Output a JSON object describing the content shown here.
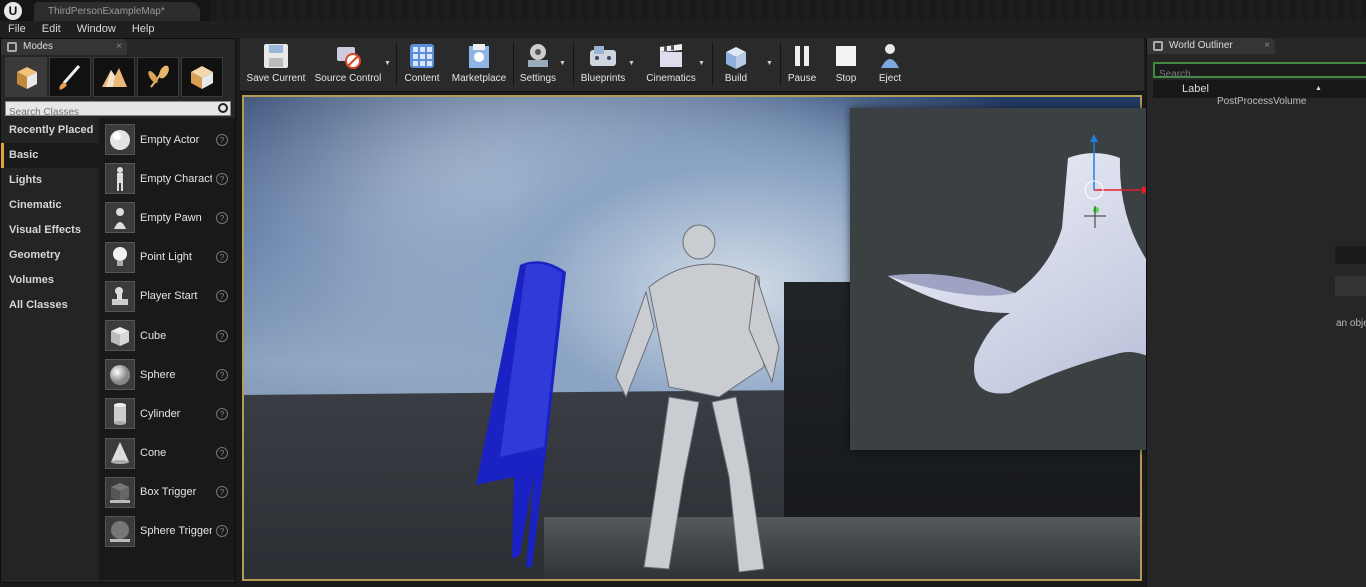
{
  "window": {
    "document_tab": "ThirdPersonExampleMap*",
    "logo": "U"
  },
  "menu": [
    "File",
    "Edit",
    "Window",
    "Help"
  ],
  "modes_panel": {
    "tab_label": "Modes",
    "search_placeholder": "Search Classes",
    "mode_icons": [
      "place-mode-icon",
      "paint-mode-icon",
      "landscape-mode-icon",
      "foliage-mode-icon",
      "geometry-mode-icon"
    ],
    "categories": [
      "Recently Placed",
      "Basic",
      "Lights",
      "Cinematic",
      "Visual Effects",
      "Geometry",
      "Volumes",
      "All Classes"
    ],
    "active_category": "Basic",
    "classes": [
      "Empty Actor",
      "Empty Charact",
      "Empty Pawn",
      "Point Light",
      "Player Start",
      "Cube",
      "Sphere",
      "Cylinder",
      "Cone",
      "Box Trigger",
      "Sphere Trigger"
    ],
    "help_glyph": "?"
  },
  "toolbar": {
    "buttons": [
      "Save Current",
      "Source Control",
      "Content",
      "Marketplace",
      "Settings",
      "Blueprints",
      "Cinematics",
      "Build",
      "Pause",
      "Stop",
      "Eject"
    ]
  },
  "world_outliner": {
    "tab_label": "World Outliner",
    "search_placeholder": "Search...",
    "column_label": "Label",
    "first_row": "PostProcessVolume",
    "partial_text": "an obje"
  },
  "colors": {
    "viewport_border": "#b39b52",
    "active_category_accent": "#e0a33c",
    "search_outline": "#3f8a3f",
    "gizmo_x": "#e0202a",
    "gizmo_z": "#2080e0"
  }
}
